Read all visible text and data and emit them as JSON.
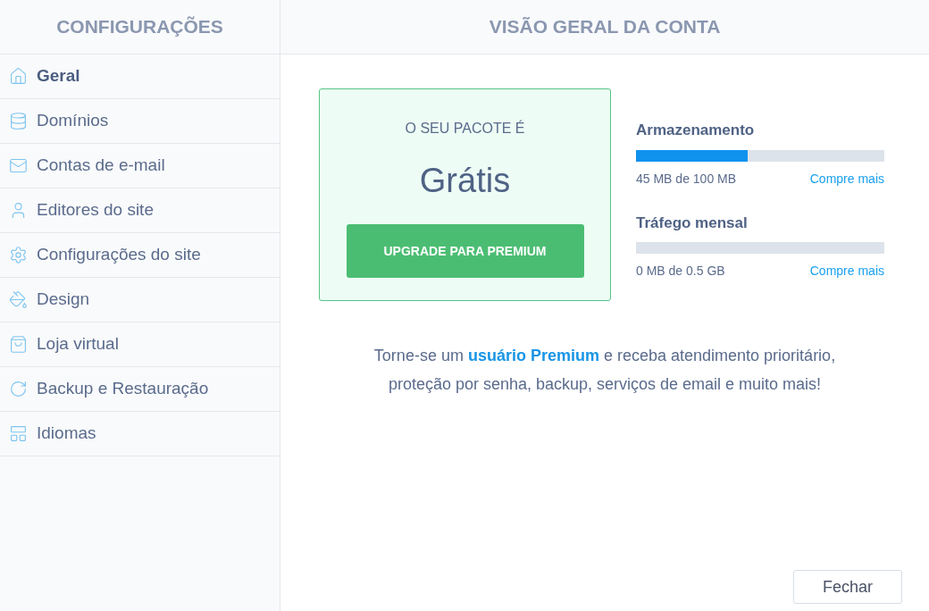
{
  "sidebar": {
    "title": "CONFIGURAÇÕES",
    "items": [
      {
        "label": "Geral",
        "kind": "home",
        "selected": true
      },
      {
        "label": "Domínios",
        "kind": "database",
        "selected": false
      },
      {
        "label": "Contas de e-mail",
        "kind": "mail",
        "selected": false
      },
      {
        "label": "Editores do site",
        "kind": "user",
        "selected": false
      },
      {
        "label": "Configurações do site",
        "kind": "gear",
        "selected": false
      },
      {
        "label": "Design",
        "kind": "bucket",
        "selected": false
      },
      {
        "label": "Loja virtual",
        "kind": "bag",
        "selected": false
      },
      {
        "label": "Backup e Restauração",
        "kind": "refresh",
        "selected": false
      },
      {
        "label": "Idiomas",
        "kind": "grid",
        "selected": false
      }
    ]
  },
  "main": {
    "title": "VISÃO GERAL DA CONTA",
    "plan": {
      "caption": "O SEU PACOTE É",
      "name": "Grátis",
      "button": "UPGRADE PARA PREMIUM"
    },
    "meters": [
      {
        "label": "Armazenamento",
        "level": 0.45,
        "reading": "45 MB de 100 MB",
        "link": "Compre mais"
      },
      {
        "label": "Tráfego mensal",
        "reading": "0 MB de 0.5 GB",
        "link": "Compre mais"
      }
    ],
    "promo": {
      "before": "Torne-se um",
      "link": "usuário Premium",
      "after": "e receba atendimento prioritário, proteção por senha, backup, serviços de email e muito mais!"
    },
    "close_button": "Fechar"
  }
}
